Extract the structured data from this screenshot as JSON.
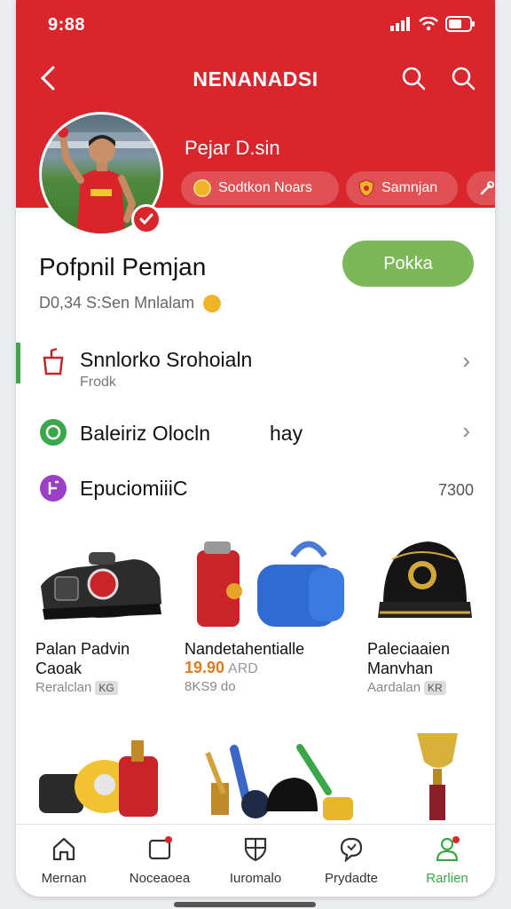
{
  "status_bar": {
    "time": "9:88"
  },
  "header": {
    "title": "NENANADSI",
    "player_name": "Pejar D.sin",
    "chips": [
      {
        "label": "Sodtkon Noars",
        "icon": "coin-icon"
      },
      {
        "label": "Samnjan",
        "icon": "shield-icon"
      },
      {
        "label": "",
        "icon": "wrench-icon"
      }
    ]
  },
  "profile": {
    "title": "Pofpnil Pemjan",
    "subtitle": "D0,34 S:Sen Mnlalam",
    "action_label": "Pokka"
  },
  "list": [
    {
      "title": "Snnlorko Srohoialn",
      "subtitle": "Frodk",
      "icon": "trophy-icon"
    },
    {
      "title": "Baleiriz Olocln",
      "trailing": "hay",
      "icon": "green-circle-icon"
    },
    {
      "title": "EpuciomiiiC",
      "value": "7300",
      "icon": "purple-circle-icon"
    }
  ],
  "products": [
    {
      "name_lines": [
        "Palan Padvin",
        "Caoak"
      ],
      "meta": "Reralclan",
      "tag": "KG"
    },
    {
      "name_lines": [
        "Nandetahentialle"
      ],
      "price": "19.90",
      "price_sub": "ARD",
      "meta": "8KS9 do"
    },
    {
      "name_lines": [
        "Paleciaaien",
        "Manvhan"
      ],
      "meta": "Aardalan",
      "tag": "KR"
    }
  ],
  "tabs": [
    {
      "label": "Mernan",
      "icon": "home-icon"
    },
    {
      "label": "Noceaoea",
      "icon": "notification-icon"
    },
    {
      "label": "Iuromalo",
      "icon": "shield-grid-icon"
    },
    {
      "label": "Prydadte",
      "icon": "chat-heart-icon"
    },
    {
      "label": "Rarlien",
      "icon": "profile-icon",
      "active": true
    }
  ],
  "colors": {
    "brand_red": "#d9262c",
    "action_green": "#7cb85a",
    "active_green": "#3aa84a",
    "price_orange": "#e07b1a"
  }
}
